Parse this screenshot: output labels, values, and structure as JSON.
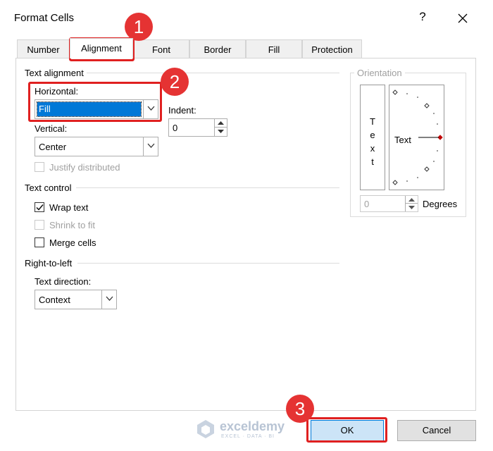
{
  "dialog": {
    "title": "Format Cells",
    "help": "?"
  },
  "tabs": [
    {
      "label": "Number",
      "active": false
    },
    {
      "label": "Alignment",
      "active": true
    },
    {
      "label": "Font",
      "active": false
    },
    {
      "label": "Border",
      "active": false
    },
    {
      "label": "Fill",
      "active": false
    },
    {
      "label": "Protection",
      "active": false
    }
  ],
  "text_alignment": {
    "group_label": "Text alignment",
    "horizontal_label": "Horizontal:",
    "horizontal_value": "Fill",
    "vertical_label": "Vertical:",
    "vertical_value": "Center",
    "indent_label": "Indent:",
    "indent_value": "0",
    "justify_distributed_label": "Justify distributed"
  },
  "text_control": {
    "group_label": "Text control",
    "wrap_text_label": "Wrap text",
    "wrap_text_checked": true,
    "shrink_label": "Shrink to fit",
    "merge_label": "Merge cells"
  },
  "rtl": {
    "group_label": "Right-to-left",
    "direction_label": "Text direction:",
    "direction_value": "Context"
  },
  "orientation": {
    "group_label": "Orientation",
    "vertical_text": [
      "T",
      "e",
      "x",
      "t"
    ],
    "text_label": "Text",
    "degrees_value": "0",
    "degrees_label": "Degrees"
  },
  "footer": {
    "ok_label": "OK",
    "cancel_label": "Cancel"
  },
  "watermark": {
    "name": "exceldemy",
    "tagline": "EXCEL · DATA · BI"
  },
  "annotations": [
    "1",
    "2",
    "3"
  ],
  "colors": {
    "highlight": "#e02020",
    "selection": "#0078d7"
  }
}
